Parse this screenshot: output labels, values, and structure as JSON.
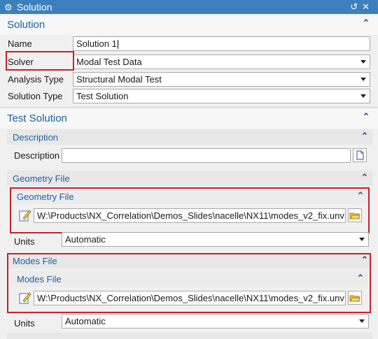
{
  "window": {
    "title": "Solution"
  },
  "solution": {
    "header": "Solution",
    "name_label": "Name",
    "name_value": "Solution 1",
    "solver_label": "Solver",
    "solver_value": "Modal Test Data",
    "analysis_label": "Analysis Type",
    "analysis_value": "Structural Modal Test",
    "solution_type_label": "Solution Type",
    "solution_type_value": "Test Solution"
  },
  "test_solution": {
    "header": "Test Solution",
    "description_group": "Description",
    "description_label": "Description",
    "description_value": "",
    "geometry_group": "Geometry File",
    "geometry_sub": "Geometry File",
    "geometry_path": "W:\\Products\\NX_Correlation\\Demos_Slides\\nacelle\\NX11\\modes_v2_fix.unv",
    "geometry_units_label": "Units",
    "geometry_units_value": "Automatic",
    "modes_group": "Modes File",
    "modes_sub": "Modes File",
    "modes_path": "W:\\Products\\NX_Correlation\\Demos_Slides\\nacelle\\NX11\\modes_v2_fix.unv",
    "modes_units_label": "Units",
    "modes_units_value": "Automatic"
  },
  "icons": {
    "title": "gear-icon",
    "reset": "reset-icon",
    "close": "close-icon",
    "collapse": "chevron-up-icon",
    "dropdown": "chevron-down-icon",
    "file_edit": "pencil-file-icon",
    "browse": "folder-open-icon",
    "document": "document-icon"
  },
  "colors": {
    "accent": "#1f5fa0",
    "titlebar": "#3d7fbd",
    "highlight": "#c8202b"
  }
}
